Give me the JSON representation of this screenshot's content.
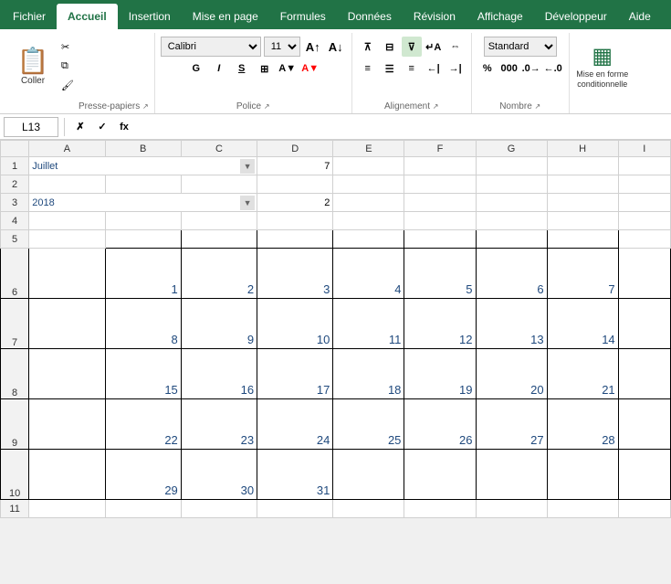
{
  "tabs": [
    {
      "label": "Fichier",
      "active": false
    },
    {
      "label": "Accueil",
      "active": true
    },
    {
      "label": "Insertion",
      "active": false
    },
    {
      "label": "Mise en page",
      "active": false
    },
    {
      "label": "Formules",
      "active": false
    },
    {
      "label": "Données",
      "active": false
    },
    {
      "label": "Révision",
      "active": false
    },
    {
      "label": "Affichage",
      "active": false
    },
    {
      "label": "Développeur",
      "active": false
    },
    {
      "label": "Aide",
      "active": false
    }
  ],
  "ribbon": {
    "clipboard_label": "Presse-papiers",
    "paste_label": "Coller",
    "font_label": "Police",
    "alignment_label": "Alignement",
    "number_label": "Nombre",
    "styles_label": "Mise en forme\nconditionnelle",
    "font_name": "Calibri",
    "font_size": "11",
    "font_style_bold": "G",
    "font_style_italic": "I",
    "font_style_underline": "S",
    "number_format": "Standard"
  },
  "formula_bar": {
    "cell_ref": "L13",
    "formula": ""
  },
  "spreadsheet": {
    "col_headers": [
      "",
      "A",
      "B",
      "C",
      "D",
      "E",
      "F",
      "G",
      "H",
      "I"
    ],
    "rows": [
      {
        "row_num": "1",
        "cells": [
          {
            "col": "A",
            "value": "Juillet",
            "type": "month",
            "dropdown": true,
            "span": 3
          },
          {
            "col": "D",
            "value": "7",
            "type": "number"
          }
        ]
      },
      {
        "row_num": "2",
        "cells": []
      },
      {
        "row_num": "3",
        "cells": [
          {
            "col": "A",
            "value": "2018",
            "type": "year",
            "dropdown": true,
            "span": 3
          },
          {
            "col": "D",
            "value": "2",
            "type": "number"
          }
        ]
      },
      {
        "row_num": "4",
        "cells": []
      },
      {
        "row_num": "5",
        "cells": []
      }
    ],
    "calendar_rows": [
      {
        "row_num": "6",
        "days": [
          "",
          "1",
          "2",
          "3",
          "4",
          "5",
          "6",
          "7"
        ]
      },
      {
        "row_num": "7",
        "days": [
          "",
          "8",
          "9",
          "10",
          "11",
          "12",
          "13",
          "14"
        ]
      },
      {
        "row_num": "8",
        "days": [
          "",
          "15",
          "16",
          "17",
          "18",
          "19",
          "20",
          "21"
        ]
      },
      {
        "row_num": "9",
        "days": [
          "",
          "22",
          "23",
          "24",
          "25",
          "26",
          "27",
          "28"
        ]
      },
      {
        "row_num": "10",
        "days": [
          "",
          "29",
          "30",
          "31",
          "",
          "",
          "",
          ""
        ]
      }
    ]
  }
}
